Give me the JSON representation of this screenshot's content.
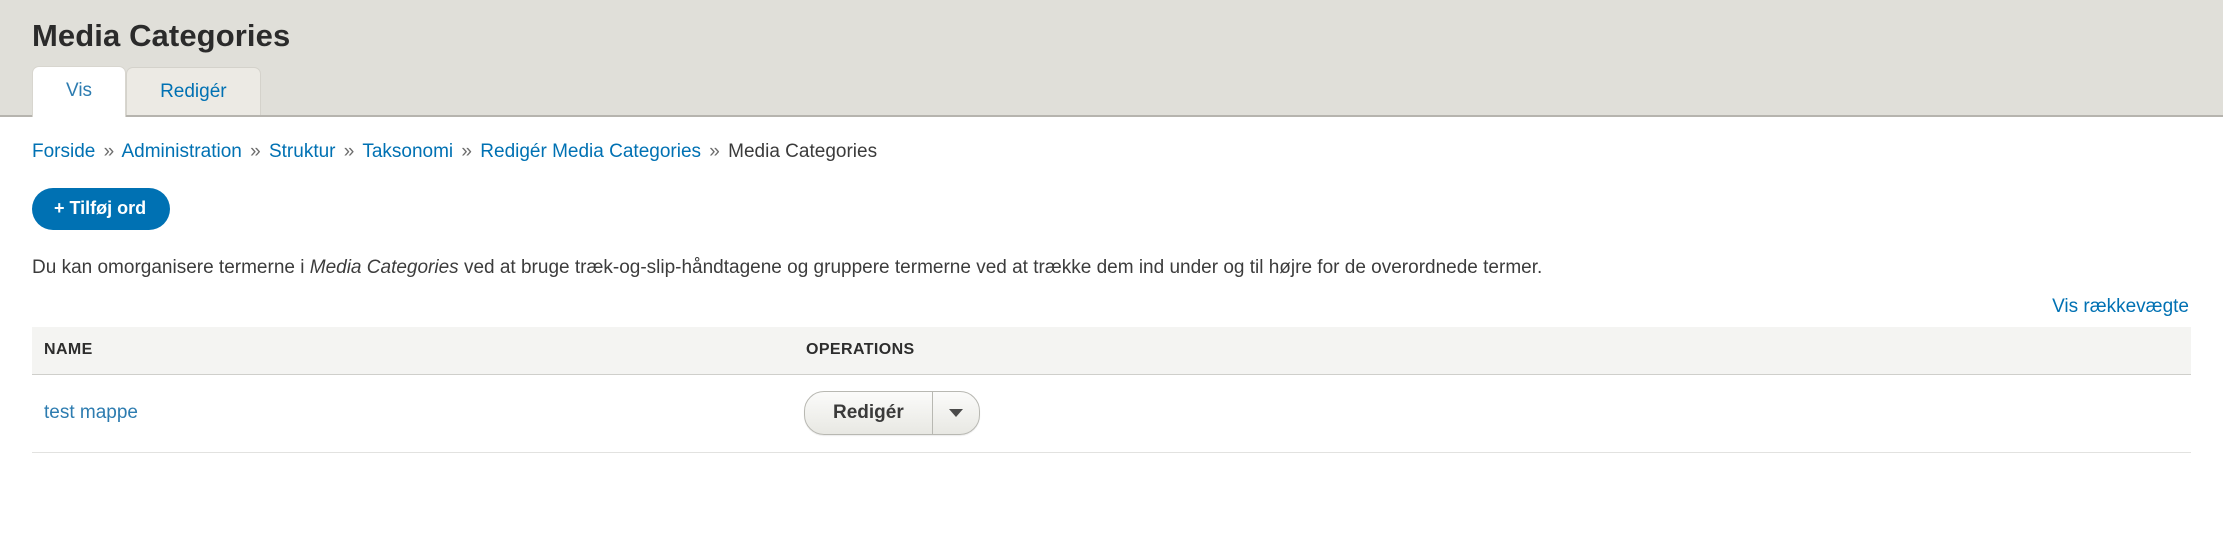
{
  "header": {
    "title": "Media Categories"
  },
  "tabs": [
    {
      "label": "Vis",
      "active": true
    },
    {
      "label": "Redigér",
      "active": false
    }
  ],
  "breadcrumb": {
    "separator": "»",
    "items": [
      {
        "label": "Forside",
        "is_link": true
      },
      {
        "label": "Administration",
        "is_link": true
      },
      {
        "label": "Struktur",
        "is_link": true
      },
      {
        "label": "Taksonomi",
        "is_link": true
      },
      {
        "label": "Redigér Media Categories",
        "is_link": true
      },
      {
        "label": "Media Categories",
        "is_link": false
      }
    ]
  },
  "actions": {
    "add_term_label": "+ Tilføj ord"
  },
  "help": {
    "text_before": "Du kan omorganisere termerne i ",
    "vocabulary_name": "Media Categories",
    "text_after": " ved at bruge træk-og-slip-håndtagene og gruppere termerne ved at trække dem ind under og til højre for de overordnede termer."
  },
  "weights_link": {
    "label": "Vis rækkevægte"
  },
  "table": {
    "columns": [
      {
        "key": "name",
        "label": "NAME"
      },
      {
        "key": "operations",
        "label": "OPERATIONS"
      }
    ],
    "rows": [
      {
        "name": "test mappe",
        "operation_label": "Redigér",
        "toggle_icon": "chevron-down-icon"
      }
    ]
  },
  "colors": {
    "header_background": "#e0dfd9",
    "content_background": "#ffffff",
    "link": "#0071b3",
    "primary_button": "#0071b3",
    "table_header_background": "#f4f4f2",
    "text": "#333333"
  }
}
